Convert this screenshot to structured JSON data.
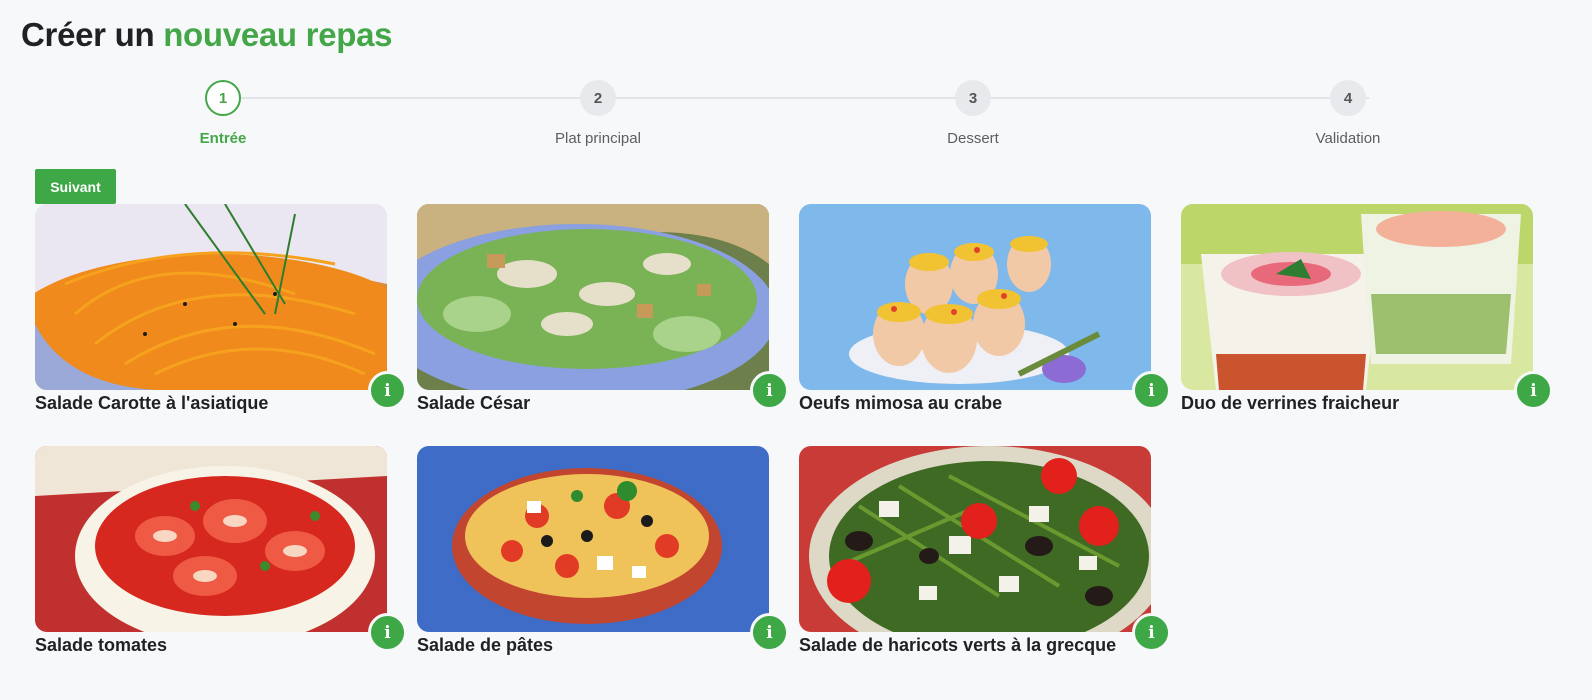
{
  "header": {
    "title_part1": "Créer un ",
    "title_accent": "nouveau repas"
  },
  "stepper": {
    "steps": [
      {
        "number": "1",
        "label": "Entrée",
        "active": true
      },
      {
        "number": "2",
        "label": "Plat principal",
        "active": false
      },
      {
        "number": "3",
        "label": "Dessert",
        "active": false
      },
      {
        "number": "4",
        "label": "Validation",
        "active": false
      }
    ]
  },
  "actions": {
    "next_label": "Suivant"
  },
  "info_icon_glyph": "i",
  "colors": {
    "accent": "#43a748",
    "background": "#f7f8fa"
  },
  "dishes": [
    {
      "name": "Salade Carotte à l'asiatique"
    },
    {
      "name": "Salade César"
    },
    {
      "name": "Oeufs mimosa au crabe"
    },
    {
      "name": "Duo de verrines fraicheur"
    },
    {
      "name": "Salade tomates"
    },
    {
      "name": "Salade de pâtes"
    },
    {
      "name": "Salade de haricots verts à la grecque"
    }
  ]
}
